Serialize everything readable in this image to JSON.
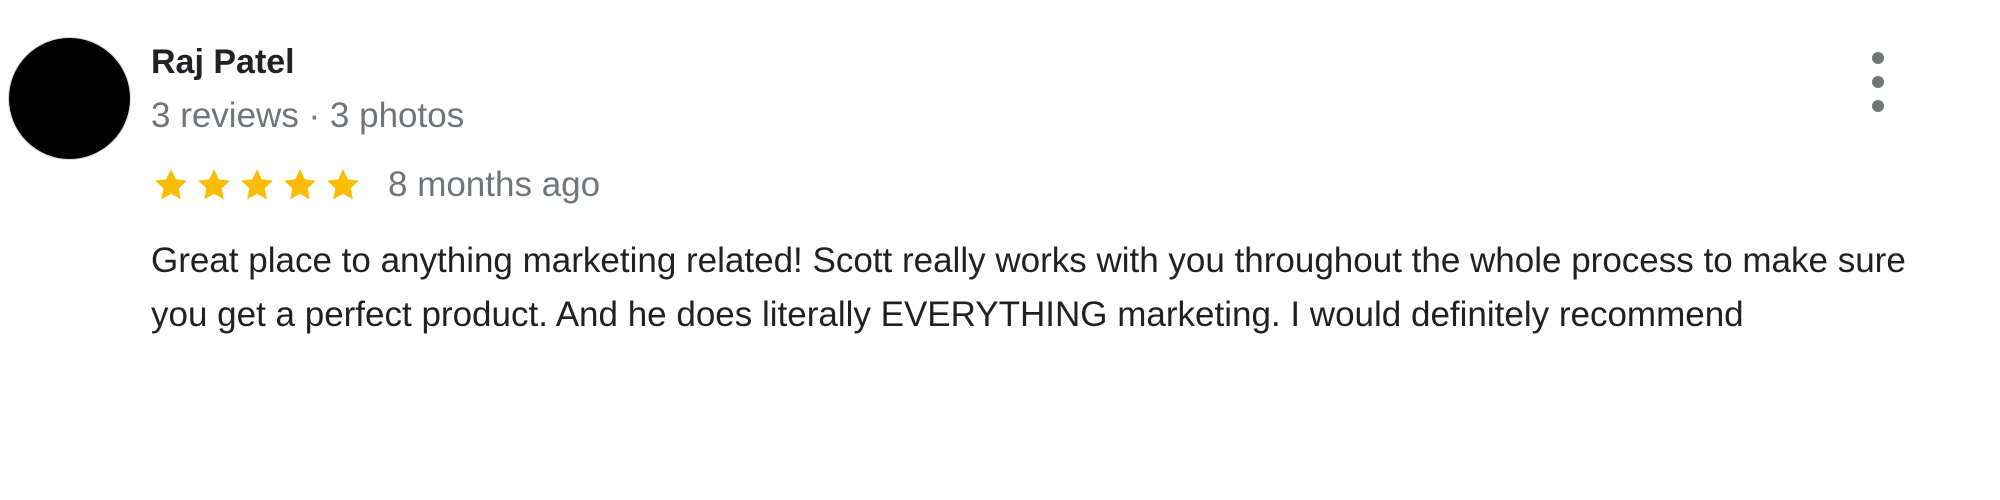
{
  "review": {
    "reviewer": {
      "name": "Raj Patel",
      "meta": "3 reviews · 3 photos"
    },
    "rating": {
      "stars": 5,
      "max_stars": 5,
      "star_color": "#fbbc04",
      "star_icon": "star-icon"
    },
    "time": "8 months ago",
    "text": "Great place to anything marketing related! Scott really works with you throughout the whole process to make sure you get a perfect product. And he does literally EVERYTHING marketing. I would definitely recommend",
    "more_icon": "more-vertical-icon"
  },
  "colors": {
    "name": "#202124",
    "secondary": "#70757a",
    "avatar": "#000000"
  }
}
